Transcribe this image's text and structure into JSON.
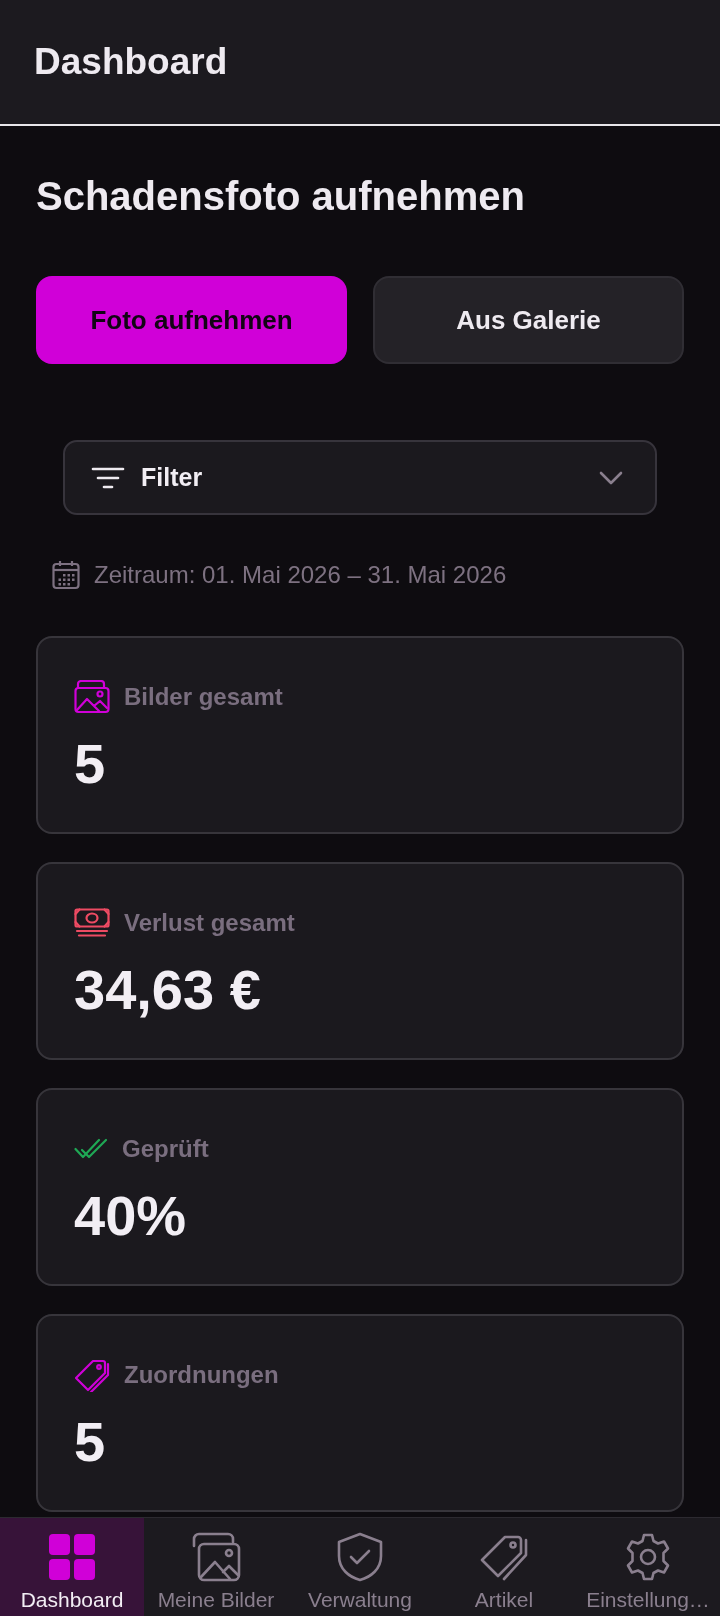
{
  "app_bar": {
    "title": "Dashboard"
  },
  "section": {
    "title": "Schadensfoto aufnehmen"
  },
  "actions": [
    {
      "label": "Foto aufnehmen",
      "kind": "primary"
    },
    {
      "label": "Aus Galerie",
      "kind": "secondary"
    }
  ],
  "filter": {
    "label": "Filter",
    "expanded": false
  },
  "date_range": "Zeitraum: 01. Mai 2026 – 31. Mai 2026",
  "stats": [
    {
      "kind": "images",
      "label": "Bilder gesamt",
      "value": "5",
      "color": "#d000d8"
    },
    {
      "kind": "money",
      "label": "Verlust gesamt",
      "value": "34,63 €",
      "color": "#ee4b63"
    },
    {
      "kind": "check",
      "label": "Geprüft",
      "value": "40%",
      "color": "#1fa855"
    },
    {
      "kind": "tag",
      "label": "Zuordnungen",
      "value": "5",
      "color": "#d000d8"
    }
  ],
  "nav": [
    {
      "kind": "grid",
      "label": "Dashboard",
      "selected": true
    },
    {
      "kind": "images",
      "label": "Meine Bilder",
      "selected": false
    },
    {
      "kind": "shield",
      "label": "Verwaltung",
      "selected": false
    },
    {
      "kind": "tag",
      "label": "Artikel",
      "selected": false
    },
    {
      "kind": "gear",
      "label": "Einstellung…",
      "selected": false
    }
  ]
}
